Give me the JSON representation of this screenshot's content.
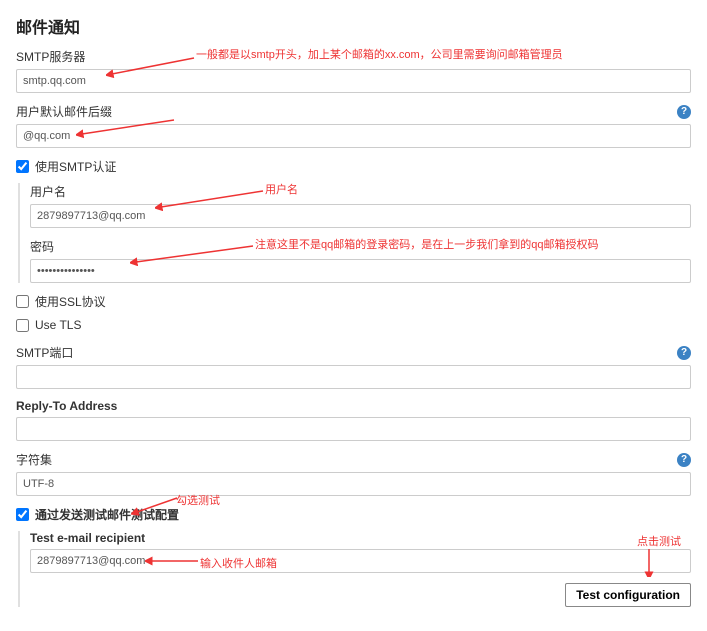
{
  "title": "邮件通知",
  "smtp_server": {
    "label": "SMTP服务器",
    "value": "smtp.qq.com"
  },
  "default_suffix": {
    "label": "用户默认邮件后缀",
    "value": "@qq.com"
  },
  "smtp_auth": {
    "label": "使用SMTP认证",
    "checked": true,
    "username_label": "用户名",
    "username_value": "2879897713@qq.com",
    "password_label": "密码",
    "password_value": "•••••••••••••••"
  },
  "use_ssl": {
    "label": "使用SSL协议",
    "checked": false
  },
  "use_tls": {
    "label": "Use TLS",
    "checked": false
  },
  "smtp_port": {
    "label": "SMTP端口",
    "value": ""
  },
  "reply_to": {
    "label": "Reply-To Address",
    "value": ""
  },
  "charset": {
    "label": "字符集",
    "value": "UTF-8"
  },
  "test_config": {
    "label_checkbox": "通过发送测试邮件测试配置",
    "checked": true,
    "recipient_label": "Test e-mail recipient",
    "recipient_value": "2879897713@qq.com",
    "button": "Test configuration"
  },
  "annotations": {
    "smtp_hint": "一般都是以smtp开头，加上某个邮箱的xx.com，公司里需要询问邮箱管理员",
    "username_hint": "用户名",
    "password_hint": "注意这里不是qq邮箱的登录密码，是在上一步我们拿到的qq邮箱授权码",
    "check_hint": "勾选测试",
    "recipient_hint": "输入收件人邮箱",
    "click_hint": "点击测试"
  }
}
